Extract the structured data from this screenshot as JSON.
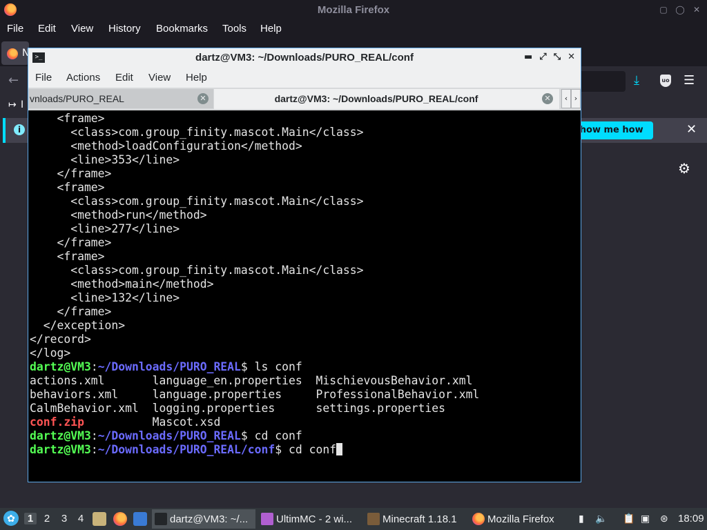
{
  "firefox": {
    "window_title": "Mozilla Firefox",
    "menu": [
      "File",
      "Edit",
      "View",
      "History",
      "Bookmarks",
      "Tools",
      "Help"
    ],
    "tab_label": "N",
    "bookmark_label": "I",
    "notification_button": "Show me how"
  },
  "terminal": {
    "window_title": "dartz@VM3: ~/Downloads/PURO_REAL/conf",
    "menu": [
      "File",
      "Actions",
      "Edit",
      "View",
      "Help"
    ],
    "tabs": [
      {
        "label": "vnloads/PURO_REAL"
      },
      {
        "label": "dartz@VM3: ~/Downloads/PURO_REAL/conf"
      }
    ],
    "lines": [
      "    <frame>",
      "      <class>com.group_finity.mascot.Main</class>",
      "      <method>loadConfiguration</method>",
      "      <line>353</line>",
      "    </frame>",
      "    <frame>",
      "      <class>com.group_finity.mascot.Main</class>",
      "      <method>run</method>",
      "      <line>277</line>",
      "    </frame>",
      "    <frame>",
      "      <class>com.group_finity.mascot.Main</class>",
      "      <method>main</method>",
      "      <line>132</line>",
      "    </frame>",
      "  </exception>",
      "</record>",
      "</log>"
    ],
    "prompt_user": "dartz@VM3",
    "prompt_colon": ":",
    "prompt_path": "~/Downloads/PURO_REAL",
    "prompt_path_conf": "~/Downloads/PURO_REAL/conf",
    "prompt_dollar": "$ ",
    "cmd1": "ls conf",
    "ls_rows": [
      [
        "actions.xml       ",
        "language_en.properties  ",
        "MischievousBehavior.xml"
      ],
      [
        "behaviors.xml     ",
        "language.properties     ",
        "ProfessionalBehavior.xml"
      ],
      [
        "CalmBehavior.xml  ",
        "logging.properties      ",
        "settings.properties"
      ],
      [
        "conf.zip",
        "          Mascot.xsd",
        ""
      ]
    ],
    "cmd2": "cd conf",
    "cmd3": "cd conf"
  },
  "taskbar": {
    "workspaces": [
      "1",
      "2",
      "3",
      "4"
    ],
    "tasks": [
      {
        "label": "dartz@VM3: ~/..."
      },
      {
        "label": "UltimMC - 2 wi..."
      },
      {
        "label": "Minecraft 1.18.1"
      },
      {
        "label": "Mozilla Firefox"
      }
    ],
    "clock": "18:09"
  },
  "colors": {
    "prompt_user": "#54ff54",
    "prompt_path": "#6b6bff",
    "archive_file": "#ff5454",
    "accent": "#00ddff",
    "window_border": "#5da9e9"
  }
}
